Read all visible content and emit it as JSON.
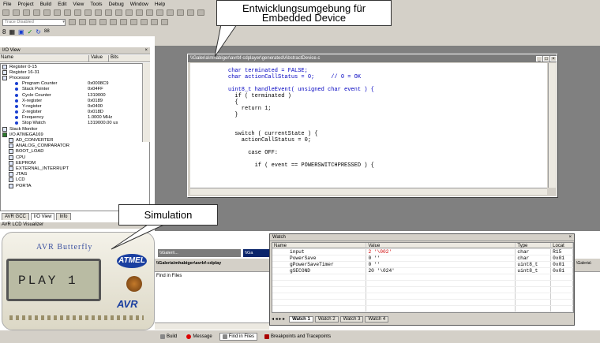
{
  "menu": [
    "File",
    "Project",
    "Build",
    "Edit",
    "View",
    "Tools",
    "Debug",
    "Window",
    "Help"
  ],
  "trace_combo": "Trace Disabled",
  "callouts": {
    "top": "Entwicklungsumgebung für\nEmbedded Device",
    "bottom": "Simulation"
  },
  "io_view": {
    "title": "I/O View",
    "col_name": "Name",
    "col_value": "Value",
    "col_bits": "Bits",
    "rows": [
      {
        "label": "Register 0-15",
        "value": "",
        "indent": 0,
        "kind": "folder"
      },
      {
        "label": "Register 16-31",
        "value": "",
        "indent": 0,
        "kind": "folder"
      },
      {
        "label": "Processor",
        "value": "",
        "indent": 0,
        "kind": "folder"
      },
      {
        "label": "Program Counter",
        "value": "0x0008C9",
        "indent": 2,
        "kind": "item"
      },
      {
        "label": "Stack Pointer",
        "value": "0x04FF",
        "indent": 2,
        "kind": "item"
      },
      {
        "label": "Cycle Counter",
        "value": "1319000",
        "indent": 2,
        "kind": "item"
      },
      {
        "label": "X-register",
        "value": "0x0189",
        "indent": 2,
        "kind": "item"
      },
      {
        "label": "Y-register",
        "value": "0x0400",
        "indent": 2,
        "kind": "item"
      },
      {
        "label": "Z-register",
        "value": "0x018D",
        "indent": 2,
        "kind": "item"
      },
      {
        "label": "Frequency",
        "value": "1.0000 MHz",
        "indent": 2,
        "kind": "item"
      },
      {
        "label": "Stop Watch",
        "value": "1319000.00 us",
        "indent": 2,
        "kind": "item"
      },
      {
        "label": "Stack Monitor",
        "value": "",
        "indent": 0,
        "kind": "folder"
      },
      {
        "label": "I/O ATMEGA169",
        "value": "",
        "indent": 0,
        "kind": "chip"
      },
      {
        "label": "AD_CONVERTER",
        "value": "",
        "indent": 1,
        "kind": "folder"
      },
      {
        "label": "ANALOG_COMPARATOR",
        "value": "",
        "indent": 1,
        "kind": "folder"
      },
      {
        "label": "BOOT_LOAD",
        "value": "",
        "indent": 1,
        "kind": "folder"
      },
      {
        "label": "CPU",
        "value": "",
        "indent": 1,
        "kind": "folder"
      },
      {
        "label": "EEPROM",
        "value": "",
        "indent": 1,
        "kind": "folder"
      },
      {
        "label": "EXTERNAL_INTERRUPT",
        "value": "",
        "indent": 1,
        "kind": "folder"
      },
      {
        "label": "JTAG",
        "value": "",
        "indent": 1,
        "kind": "folder"
      },
      {
        "label": "LCD",
        "value": "",
        "indent": 1,
        "kind": "folder"
      },
      {
        "label": "PORTA",
        "value": "",
        "indent": 1,
        "kind": "folder"
      }
    ],
    "tabs": [
      "AVR GCC",
      "I/O View",
      "Info"
    ]
  },
  "lcd_visualizer": {
    "title": "AVR LCD Visualizer",
    "brand": "AVR Butterfly",
    "lcd_text": "PLAY 1",
    "logo1": "ATMEL",
    "logo2": "AVR"
  },
  "editor": {
    "title": "\\\\Galeria\\mhabiger\\avrbf-cdplayer\\generated\\AbstractDevice.c",
    "lines": [
      {
        "t": "char terminated = FALSE;"
      },
      {
        "t": "char actionCallStatus = 0;     // 0 = OK"
      },
      {
        "t": ""
      },
      {
        "t": "uint8_t handleEvent( unsigned char event ) {"
      },
      {
        "t": "  if ( terminated )"
      },
      {
        "t": "  {"
      },
      {
        "t": "    return 1;"
      },
      {
        "t": "  }"
      },
      {
        "t": ""
      },
      {
        "t": ""
      },
      {
        "t": "  switch ( currentState ) {"
      },
      {
        "t": "    actionCallStatus = 0;"
      },
      {
        "t": ""
      },
      {
        "t": "      case OFF:"
      },
      {
        "t": ""
      },
      {
        "t": "        if ( event == POWERSWITCHPRESSED ) {"
      }
    ]
  },
  "lower_windows": {
    "win1": "\\\\Galeri\\...",
    "win2": "\\\\Ga",
    "path_bar": "\\\\Galeria\\mhabiger\\avrbf-cdplay",
    "path_right": "\\Galeria\\",
    "find_in_files": "Find in Files"
  },
  "watch": {
    "title": "Watch",
    "headers": [
      "Name",
      "Value",
      "Type",
      "Locat"
    ],
    "rows": [
      {
        "name": "input",
        "value": "2 '\\002'",
        "type": "char",
        "loc": "R15",
        "highlight": true
      },
      {
        "name": "PowerSave",
        "value": "0 ''",
        "type": "char",
        "loc": "0x01",
        "highlight": false
      },
      {
        "name": "gPowerSaveTimer",
        "value": "0 ''",
        "type": "uint8_t",
        "loc": "0x01",
        "highlight": false
      },
      {
        "name": "gSECOND",
        "value": "20 '\\024'",
        "type": "uint8_t",
        "loc": "0x01",
        "highlight": false
      }
    ],
    "tabs": [
      "Watch 1",
      "Watch 2",
      "Watch 3",
      "Watch 4"
    ]
  },
  "status_tabs": [
    "Build",
    "Message",
    "Find in Files",
    "Breakpoints and Tracepoints"
  ]
}
